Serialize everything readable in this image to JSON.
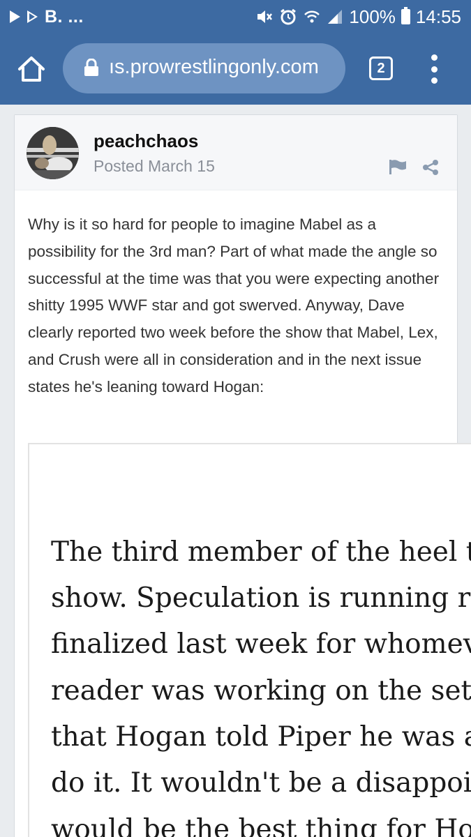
{
  "status_bar": {
    "left_text": "B. ...",
    "battery": "100%",
    "time": "14:55"
  },
  "browser": {
    "url": "ıs.prowrestlingonly.com",
    "tab_count": "2"
  },
  "post": {
    "author": "peachchaos",
    "posted": "Posted March 15",
    "body": "Why is it so hard for people to imagine Mabel as a possibility for the 3rd man? Part of what made the angle so successful at the time was that you were expecting another shitty 1995 WWF star and got swerved. Anyway, Dave clearly reported two week before the show that Mabel, Lex, and Crush were all in consideration and in the next issue states he's leaning toward Hogan:",
    "quote_lines": [
      "The third member of the heel tea",
      "show. Speculation is running ran",
      "finalized last week for whomeve",
      "reader was working on the set of",
      "that Hogan told Piper he was ask",
      "do it. It wouldn't be a disappoint",
      "would be the best thing for Hoga"
    ]
  },
  "colors": {
    "header_blue": "#3d6aa2",
    "url_pill": "#6e93c2"
  }
}
